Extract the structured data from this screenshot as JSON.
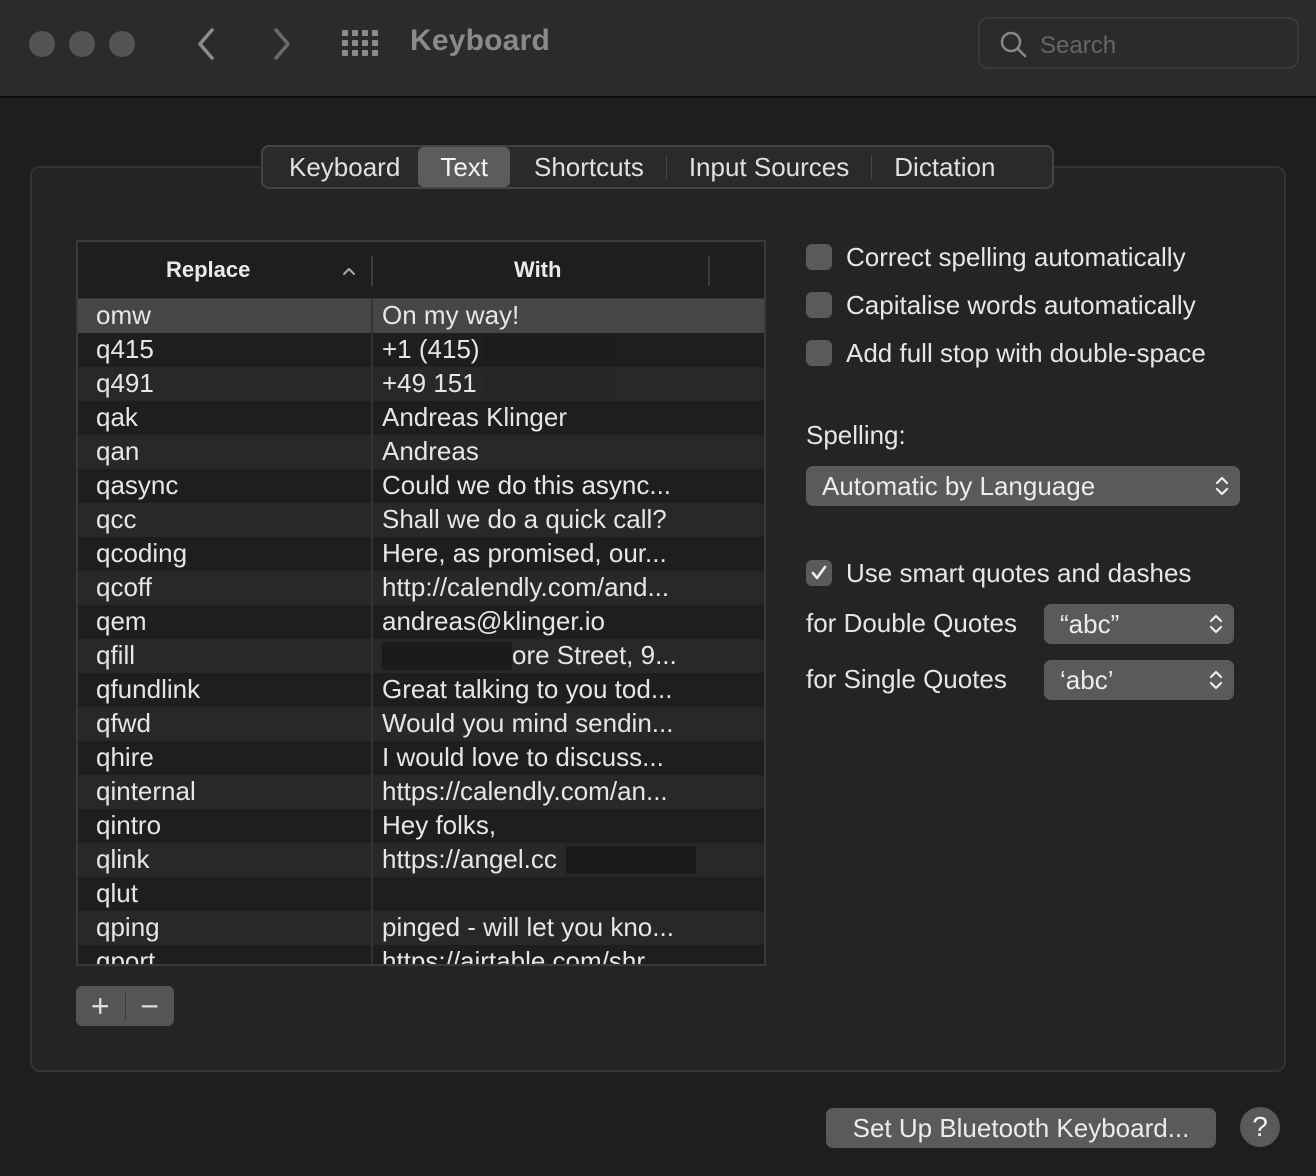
{
  "window": {
    "title": "Keyboard",
    "search_placeholder": "Search"
  },
  "tabs": [
    {
      "label": "Keyboard"
    },
    {
      "label": "Text",
      "selected": true
    },
    {
      "label": "Shortcuts"
    },
    {
      "label": "Input Sources"
    },
    {
      "label": "Dictation"
    }
  ],
  "table": {
    "headers": {
      "replace": "Replace",
      "with": "With"
    },
    "rows": [
      {
        "replace": "omw",
        "with": "On my way!"
      },
      {
        "replace": "q415",
        "with": "+1 (415)"
      },
      {
        "replace": "q491",
        "with": "+49 151"
      },
      {
        "replace": "qak",
        "with": "Andreas Klinger"
      },
      {
        "replace": "qan",
        "with": "Andreas"
      },
      {
        "replace": "qasync",
        "with": "Could we do this async..."
      },
      {
        "replace": "qcc",
        "with": "Shall we do a quick call?"
      },
      {
        "replace": "qcoding",
        "with": "Here, as promised, our..."
      },
      {
        "replace": "qcoff",
        "with": "http://calendly.com/and..."
      },
      {
        "replace": "qem",
        "with": "andreas@klinger.io"
      },
      {
        "replace": "qfill",
        "with": "ore Street, 9..."
      },
      {
        "replace": "qfundlink",
        "with": "Great talking to you tod..."
      },
      {
        "replace": "qfwd",
        "with": "Would you mind sendin..."
      },
      {
        "replace": "qhire",
        "with": "I would love to discuss..."
      },
      {
        "replace": "qinternal",
        "with": "https://calendly.com/an..."
      },
      {
        "replace": "qintro",
        "with": "Hey folks,"
      },
      {
        "replace": "qlink",
        "with": "https://angel.cc"
      },
      {
        "replace": "qlut",
        "with": ""
      },
      {
        "replace": "qping",
        "with": "pinged - will let you kno..."
      },
      {
        "replace": "qport",
        "with": "https://airtable.com/shr"
      }
    ]
  },
  "controls": {
    "add_label": "+",
    "remove_label": "−"
  },
  "options": {
    "correct_spelling": {
      "label": "Correct spelling automatically",
      "checked": false
    },
    "capitalise": {
      "label": "Capitalise words automatically",
      "checked": false
    },
    "full_stop": {
      "label": "Add full stop with double-space",
      "checked": false
    },
    "spelling_label": "Spelling:",
    "spelling_value": "Automatic by Language",
    "smart_quotes": {
      "label": "Use smart quotes and dashes",
      "checked": true
    },
    "double_quotes_label": "for Double Quotes",
    "double_quotes_value": "“abc”",
    "single_quotes_label": "for Single Quotes",
    "single_quotes_value": "‘abc’"
  },
  "footer": {
    "bluetooth_button": "Set Up Bluetooth Keyboard...",
    "help": "?"
  }
}
